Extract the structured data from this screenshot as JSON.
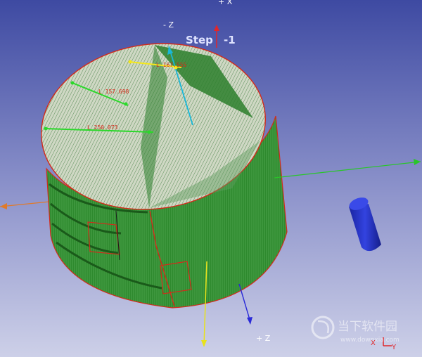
{
  "viewport": {
    "background_top": "#3e4aa2",
    "background_bottom": "#c9cce6"
  },
  "axes": {
    "plus_x": "+ X",
    "minus_z": "- Z",
    "plus_z": "+ Z"
  },
  "step": {
    "label": "Step",
    "value": "-1"
  },
  "dimensions": {
    "d1": "L 167.555",
    "d2": "L 157.698",
    "d3": "L 250.073"
  },
  "triad": {
    "x": "X",
    "y": "Y"
  },
  "watermark": {
    "cn": "当下软件园",
    "url": "www.downxia.com"
  },
  "colors": {
    "model_green": "#2f8a2f",
    "edge_red": "#d42a1a",
    "cylinder_blue": "#1f2fc8"
  }
}
